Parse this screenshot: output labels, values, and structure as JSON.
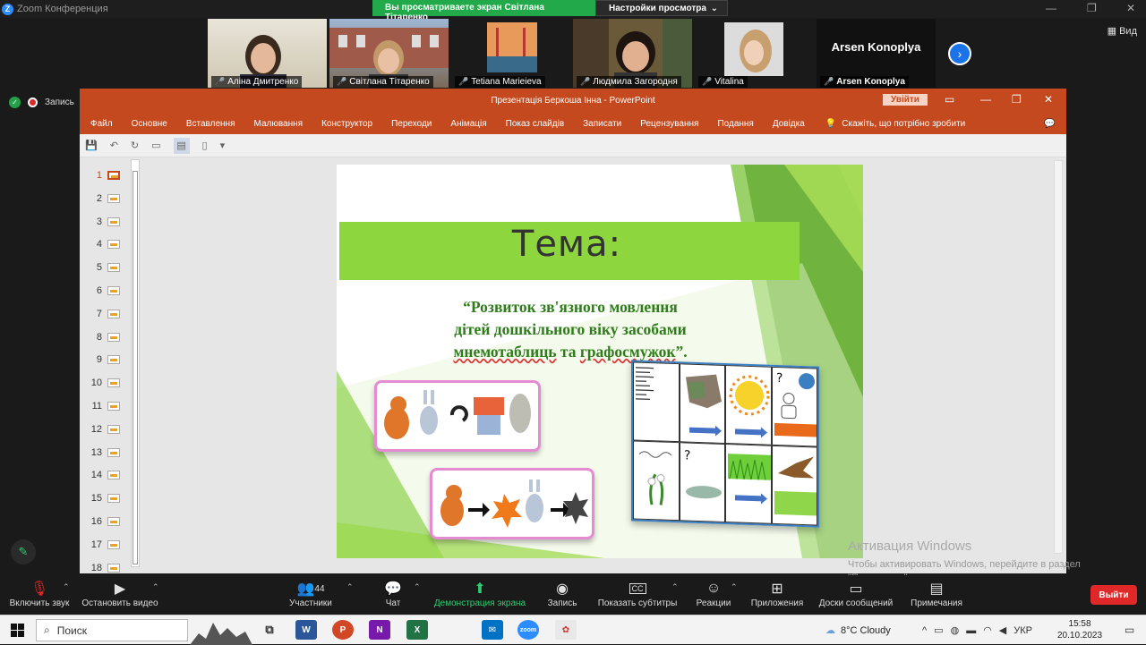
{
  "zoom": {
    "window_title": "Zoom Конференция",
    "viewing_banner": "Вы просматриваете экран Світлана Тітаренко",
    "view_settings": "Настройки просмотра",
    "view_label": "Вид",
    "record_label": "Запись",
    "participants": [
      {
        "name": "Аліна Дмитренко"
      },
      {
        "name": "Світлана Тітаренко"
      },
      {
        "name": "Tetiana Marieieva"
      },
      {
        "name": "Людмила Загородня"
      },
      {
        "name": "Vitalina"
      },
      {
        "name": "Arsen Konoplya",
        "display": "Arsen Konoplya"
      }
    ],
    "toolbar": {
      "unmute": "Включить звук",
      "stop_video": "Остановить видео",
      "participants": "Участники",
      "participants_count": "44",
      "chat": "Чат",
      "share": "Демонстрация экрана",
      "record": "Запись",
      "captions": "Показать субтитры",
      "captions_badge": "CC",
      "reactions": "Реакции",
      "apps": "Приложения",
      "whiteboards": "Доски сообщений",
      "notes": "Примечания",
      "leave": "Выйти"
    }
  },
  "powerpoint": {
    "title": "Презентація Беркоша Інна  -  PowerPoint",
    "sign_in": "Увійти",
    "tabs": [
      "Файл",
      "Основне",
      "Вставлення",
      "Малювання",
      "Конструктор",
      "Переходи",
      "Анімація",
      "Показ слайдів",
      "Записати",
      "Рецензування",
      "Подання",
      "Довідка"
    ],
    "tell_me": "Скажіть, що потрібно зробити",
    "slide_numbers": [
      "1",
      "2",
      "3",
      "4",
      "5",
      "6",
      "7",
      "8",
      "9",
      "10",
      "11",
      "12",
      "13",
      "14",
      "15",
      "16",
      "17",
      "18"
    ],
    "selected_slide": "1",
    "slide": {
      "topic": "Тема:",
      "subtitle_line1": "“Розвиток зв'язного мовлення",
      "subtitle_line2": "дітей дошкільного віку засобами",
      "subtitle_line3a": "мнемотаблиць",
      "subtitle_line3b": " та ",
      "subtitle_line3c": "графосмужок",
      "subtitle_line3d": "”."
    }
  },
  "windows": {
    "activation_title": "Активация Windows",
    "activation_text1": "Чтобы активировать Windows, перейдите в раздел",
    "activation_text2": "\"Параметры\".",
    "search": "Поиск",
    "weather": "8°C  Cloudy",
    "language": "УКР",
    "time": "15:58",
    "date": "20.10.2023"
  },
  "colors": {
    "ppt_accent": "#c4491f",
    "slide_green": "#8ed63e",
    "zoom_green": "#22a94a",
    "leave_red": "#e02828"
  }
}
